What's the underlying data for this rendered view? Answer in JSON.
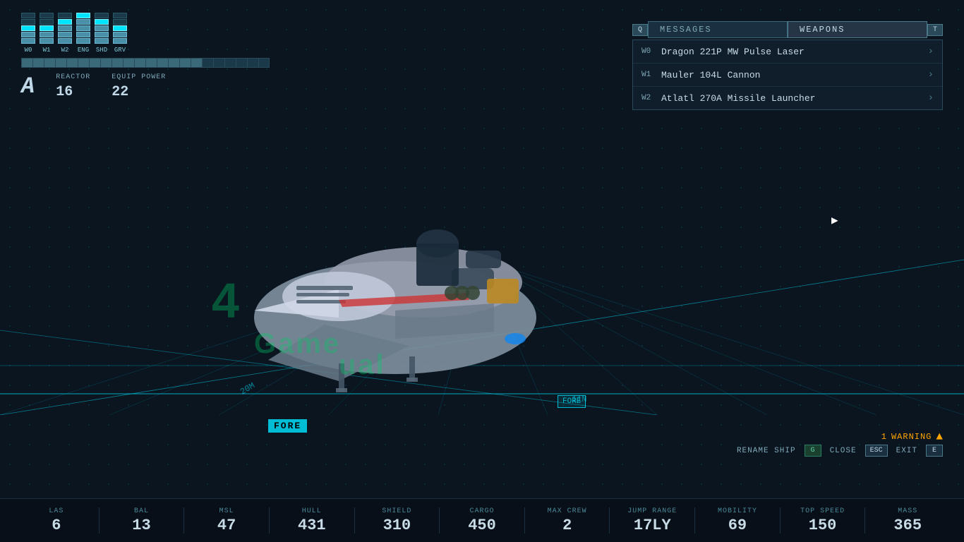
{
  "background": {
    "color": "#0a1520"
  },
  "topLeft": {
    "bars": [
      {
        "label": "W0",
        "filled": 3,
        "total": 5
      },
      {
        "label": "W1",
        "filled": 3,
        "total": 5
      },
      {
        "label": "W2",
        "filled": 4,
        "total": 5
      },
      {
        "label": "ENG",
        "filled": 5,
        "total": 5
      },
      {
        "label": "SHD",
        "filled": 4,
        "total": 5
      },
      {
        "label": "GRV",
        "filled": 3,
        "total": 5
      }
    ],
    "reactorLabel": "REACTOR",
    "reactorValue": "16",
    "equipPowerLabel": "EQUIP POWER",
    "equipPowerValue": "22",
    "gradeLabel": "A"
  },
  "rightPanel": {
    "tabQKey": "Q",
    "tabTKey": "T",
    "messagesLabel": "MESSAGES",
    "weaponsLabel": "WEAPONS",
    "weapons": [
      {
        "slot": "W0",
        "name": "Dragon 221P MW Pulse Laser"
      },
      {
        "slot": "W1",
        "name": "Mauler 104L Cannon"
      },
      {
        "slot": "W2",
        "name": "Atlatl 270A Missile Launcher"
      }
    ]
  },
  "warning": {
    "count": "1",
    "label": "WARNING"
  },
  "actionBar": {
    "renameShipLabel": "RENAME SHIP",
    "renameShipKey": "G",
    "closeLabel": "CLOSE",
    "closeKey": "ESC",
    "exitLabel": "EXIT",
    "exitKey": "E"
  },
  "foreLabels": {
    "fore1": "FORE",
    "fore2": "FORE",
    "measure20m": "20M",
    "measure11n": "11N"
  },
  "stats": [
    {
      "label": "LAS",
      "value": "6"
    },
    {
      "label": "BAL",
      "value": "13"
    },
    {
      "label": "MSL",
      "value": "47"
    },
    {
      "label": "HULL",
      "value": "431"
    },
    {
      "label": "SHIELD",
      "value": "310"
    },
    {
      "label": "CARGO",
      "value": "450"
    },
    {
      "label": "MAX CREW",
      "value": "2"
    },
    {
      "label": "JUMP RANGE",
      "value": "17LY"
    },
    {
      "label": "MOBILITY",
      "value": "69"
    },
    {
      "label": "TOP SPEED",
      "value": "150"
    },
    {
      "label": "MASS",
      "value": "365"
    }
  ]
}
